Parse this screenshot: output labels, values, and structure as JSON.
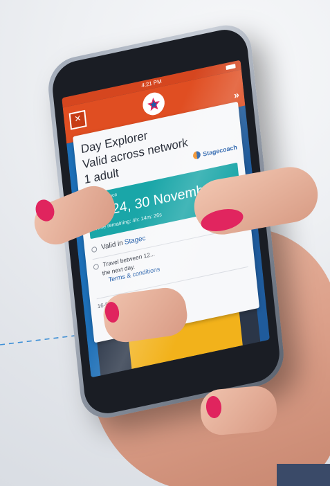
{
  "status_bar": {
    "carrier": "•••○○",
    "time": "4:21 PM"
  },
  "header": {
    "close_glyph": "×",
    "next_glyph": "»"
  },
  "ticket": {
    "title_line1": "Day Explorer",
    "title_line2": "Valid across network",
    "title_line3": "1 adult",
    "brand": "Stagecoach",
    "active_label": "Active since",
    "active_time": "13:24, 30 November 16",
    "time_remaining": "Time remaining: 4h: 14m: 26s",
    "valid_label": "Valid in",
    "valid_link": "Stagec",
    "travel_text": "Travel between 12...",
    "travel_text_2": "the next day.",
    "terms_link": "Terms & conditions",
    "ticket_id": "16-5716-20160419130947-001"
  },
  "icons": {
    "close": "close-icon",
    "next": "chevrons-right-icon",
    "logo": "stagecoach-logo-icon"
  },
  "colors": {
    "header_orange": "#e04e22",
    "active_teal": "#1aa6a8",
    "brand_blue": "#1d5aa8",
    "accent_yellow": "#f2b21b",
    "nail_pink": "#e0245e"
  }
}
